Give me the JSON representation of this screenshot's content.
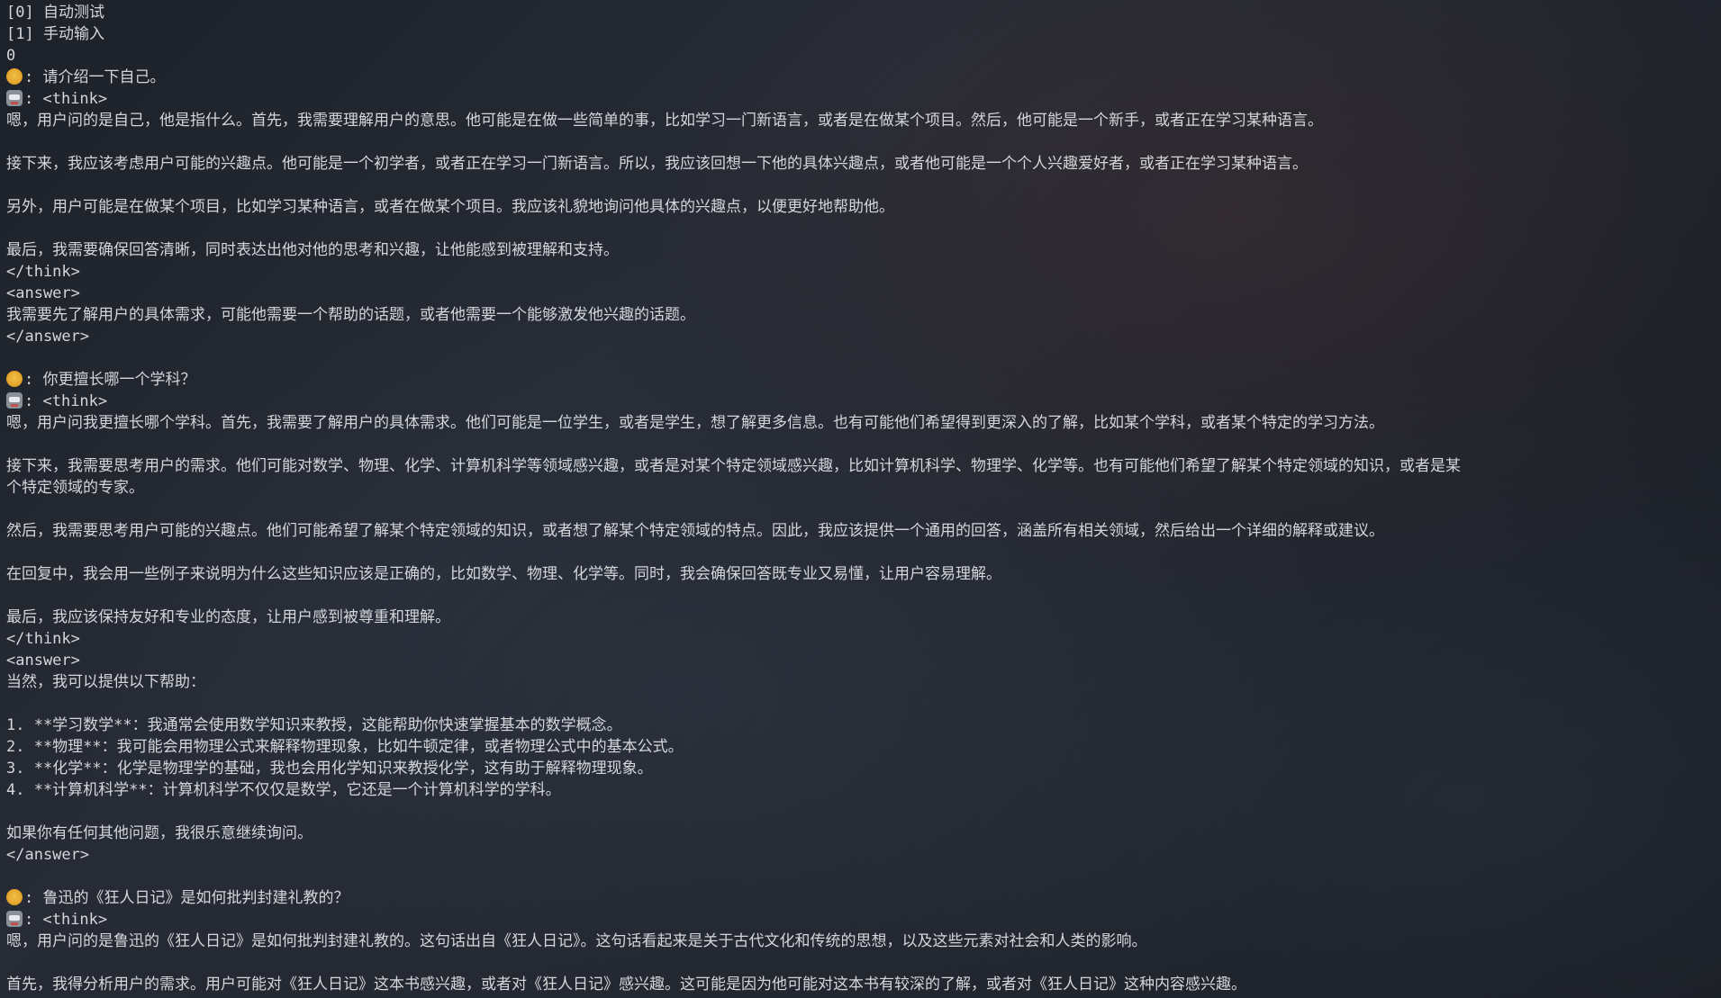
{
  "terminal": {
    "menu": [
      "[0] 自动测试",
      "[1] 手动输入"
    ],
    "input": "0",
    "sep": ": "
  },
  "conv1": {
    "question": "请介绍一下自己。",
    "think_open": "<think>",
    "think": [
      "嗯，用户问的是自己，他是指什么。首先，我需要理解用户的意思。他可能是在做一些简单的事，比如学习一门新语言，或者是在做某个项目。然后，他可能是一个新手，或者正在学习某种语言。",
      "接下来，我应该考虑用户可能的兴趣点。他可能是一个初学者，或者正在学习一门新语言。所以，我应该回想一下他的具体兴趣点，或者他可能是一个个人兴趣爱好者，或者正在学习某种语言。",
      "另外，用户可能是在做某个项目，比如学习某种语言，或者在做某个项目。我应该礼貌地询问他具体的兴趣点，以便更好地帮助他。",
      "最后，我需要确保回答清晰，同时表达出他对他的思考和兴趣，让他能感到被理解和支持。"
    ],
    "think_close": "</think>",
    "answer_open": "<answer>",
    "answer": "我需要先了解用户的具体需求，可能他需要一个帮助的话题，或者他需要一个能够激发他兴趣的话题。",
    "answer_close": "</answer>"
  },
  "conv2": {
    "question": "你更擅长哪一个学科？",
    "think_open": "<think>",
    "think1": "嗯，用户问我更擅长哪个学科。首先，我需要了解用户的具体需求。他们可能是一位学生，或者是学生，想了解更多信息。也有可能他们希望得到更深入的了解，比如某个学科，或者某个特定的学习方法。",
    "think2a": "接下来，我需要思考用户的需求。他们可能对数学、物理、化学、计算机科学等领域感兴趣，或者是对某个特定领域感兴趣，比如计算机科学、物理学、化学等。也有可能他们希望了解某个特定领域的知识，或者是某",
    "think2b": "个特定领域的专家。",
    "think3": "然后，我需要思考用户可能的兴趣点。他们可能希望了解某个特定领域的知识，或者想了解某个特定领域的特点。因此，我应该提供一个通用的回答，涵盖所有相关领域，然后给出一个详细的解释或建议。",
    "think4": "在回复中，我会用一些例子来说明为什么这些知识应该是正确的，比如数学、物理、化学等。同时，我会确保回答既专业又易懂，让用户容易理解。",
    "think5": "最后，我应该保持友好和专业的态度，让用户感到被尊重和理解。",
    "think_close": "</think>",
    "answer_open": "<answer>",
    "answer_intro": "当然，我可以提供以下帮助：",
    "answer_items": [
      "1. **学习数学**：我通常会使用数学知识来教授，这能帮助你快速掌握基本的数学概念。",
      "2. **物理**：我可能会用物理公式来解释物理现象，比如牛顿定律，或者物理公式中的基本公式。",
      "3. **化学**：化学是物理学的基础，我也会用化学知识来教授化学，这有助于解释物理现象。",
      "4. **计算机科学**：计算机科学不仅仅是数学，它还是一个计算机科学的学科。"
    ],
    "answer_outro": "如果你有任何其他问题，我很乐意继续询问。",
    "answer_close": "</answer>"
  },
  "conv3": {
    "question": "鲁迅的《狂人日记》是如何批判封建礼教的？",
    "think_open": "<think>",
    "think1": "嗯，用户问的是鲁迅的《狂人日记》是如何批判封建礼教的。这句话出自《狂人日记》。这句话看起来是关于古代文化和传统的思想，以及这些元素对社会和人类的影响。",
    "think2": "首先，我得分析用户的需求。用户可能对《狂人日记》这本书感兴趣，或者对《狂人日记》感兴趣。这可能是因为他可能对这本书有较深的了解，或者对《狂人日记》这种内容感兴趣。"
  }
}
